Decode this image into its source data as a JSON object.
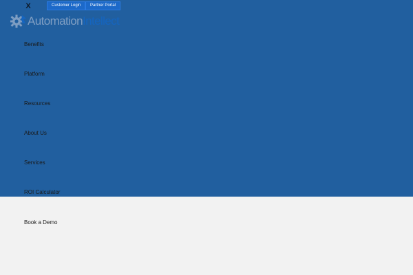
{
  "header": {
    "close_glyph": "X",
    "customer_login": "Customer Login",
    "partner_portal": "Partner Portal"
  },
  "logo": {
    "word1": "Automation",
    "word2": "Intellect"
  },
  "nav": {
    "items": [
      {
        "label": "Benefits"
      },
      {
        "label": "Platform"
      },
      {
        "label": "Resources"
      },
      {
        "label": "About Us"
      },
      {
        "label": "Services"
      },
      {
        "label": "ROI Calculator"
      },
      {
        "label": "Book a Demo"
      }
    ]
  },
  "colors": {
    "panel_blue": "#215f9f",
    "button_blue": "#1c69c9",
    "page_bg": "#f2f2f2",
    "logo_gray": "#7f9ec3",
    "logo_blue": "#1565c0"
  },
  "icons": {
    "close": "close-icon",
    "logo": "gear-logo-icon"
  }
}
